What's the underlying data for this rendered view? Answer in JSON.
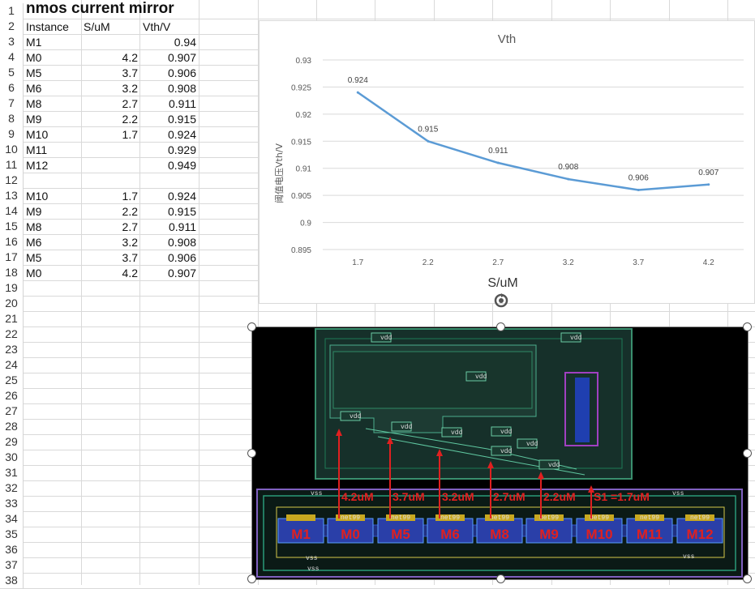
{
  "sheet": {
    "title": "nmos current mirror",
    "row_numbers": [
      "1",
      "2",
      "3",
      "4",
      "5",
      "6",
      "7",
      "8",
      "9",
      "10",
      "11",
      "12",
      "13",
      "14",
      "15",
      "16",
      "17",
      "18",
      "19",
      "20",
      "21",
      "22",
      "23",
      "24",
      "25",
      "26",
      "27",
      "28",
      "29",
      "30",
      "31",
      "32",
      "33",
      "34",
      "35",
      "36",
      "37",
      "38"
    ],
    "headers": [
      "Instance",
      "S/uM",
      "Vth/V"
    ],
    "table1": [
      {
        "inst": "M1",
        "s": "",
        "v": "0.94"
      },
      {
        "inst": "M0",
        "s": "4.2",
        "v": "0.907"
      },
      {
        "inst": "M5",
        "s": "3.7",
        "v": "0.906"
      },
      {
        "inst": "M6",
        "s": "3.2",
        "v": "0.908"
      },
      {
        "inst": "M8",
        "s": "2.7",
        "v": "0.911"
      },
      {
        "inst": "M9",
        "s": "2.2",
        "v": "0.915"
      },
      {
        "inst": "M10",
        "s": "1.7",
        "v": "0.924"
      },
      {
        "inst": "M11",
        "s": "",
        "v": "0.929"
      },
      {
        "inst": "M12",
        "s": "",
        "v": "0.949"
      }
    ],
    "table2": [
      {
        "inst": "M10",
        "s": "1.7",
        "v": "0.924"
      },
      {
        "inst": "M9",
        "s": "2.2",
        "v": "0.915"
      },
      {
        "inst": "M8",
        "s": "2.7",
        "v": "0.911"
      },
      {
        "inst": "M6",
        "s": "3.2",
        "v": "0.908"
      },
      {
        "inst": "M5",
        "s": "3.7",
        "v": "0.906"
      },
      {
        "inst": "M0",
        "s": "4.2",
        "v": "0.907"
      }
    ]
  },
  "chart_data": {
    "type": "line",
    "title": "Vth",
    "xlabel": "S/uM",
    "ylabel": "阈值电压Vth/V",
    "categories": [
      "1.7",
      "2.2",
      "2.7",
      "3.2",
      "3.7",
      "4.2"
    ],
    "values": [
      0.924,
      0.915,
      0.911,
      0.908,
      0.906,
      0.907
    ],
    "data_labels": [
      "0.924",
      "0.915",
      "0.911",
      "0.908",
      "0.906",
      "0.907"
    ],
    "ylim": [
      0.895,
      0.93
    ],
    "y_ticks": [
      "0.93",
      "0.925",
      "0.92",
      "0.915",
      "0.91",
      "0.905",
      "0.9",
      "0.895"
    ],
    "grid": true,
    "line_color": "#5b9bd5"
  },
  "layout_image": {
    "devices": [
      "M1",
      "M0",
      "M5",
      "M6",
      "M8",
      "M9",
      "M10",
      "M11",
      "M12"
    ],
    "sizes": [
      "4.2uM",
      "3.7uM",
      "3.2uM",
      "2.7uM",
      "2.2uM",
      "S1 =1.7uM"
    ],
    "net_vdd": "vdd",
    "net_vss": "vss",
    "net_99": "net99",
    "annotation_color": "#e02020"
  }
}
